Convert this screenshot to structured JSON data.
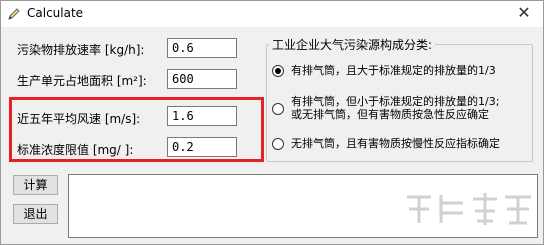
{
  "window": {
    "title": "Calculate",
    "close_symbol": "✕"
  },
  "fields": [
    {
      "label": "污染物排放速率  [kg/h]:",
      "value": "0.6"
    },
    {
      "label": "生产单元占地面积  [m²]:",
      "value": "600"
    },
    {
      "label": "近五年平均风速   [m/s]:",
      "value": "1.6"
    },
    {
      "label": "标准浓度限值  [mg/  ]:",
      "value": "0.2"
    }
  ],
  "group": {
    "title": "工业企业大气污染源构成分类:",
    "options": [
      {
        "line1": "有排气筒，且大于标准规定的排放量的1/3",
        "line2": "",
        "checked": true
      },
      {
        "line1": "有排气筒，但小于标准规定的排放量的1/3;",
        "line2": "或无排气筒，但有害物质按急性反应确定",
        "checked": false
      },
      {
        "line1": "无排气筒，且有害物质按慢性反应指标确定",
        "line2": "",
        "checked": false
      }
    ]
  },
  "buttons": {
    "calculate": "计算",
    "exit": "退出"
  },
  "output": {
    "value": ""
  },
  "colors": {
    "highlight": "#e52126"
  }
}
